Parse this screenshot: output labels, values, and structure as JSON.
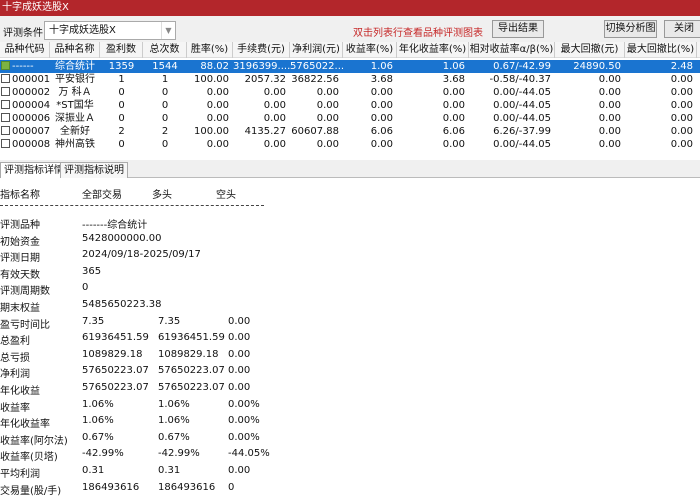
{
  "window": {
    "title": "十字成妖选股X"
  },
  "toolbar": {
    "condition_label": "评测条件:",
    "condition_value": "十字成妖选股X",
    "hint": "双击列表行查看品种评测图表",
    "export": "导出结果",
    "switch_chart": "切换分析图",
    "close": "关闭"
  },
  "table": {
    "headers": [
      "品种代码",
      "品种名称",
      "盈利数",
      "总次数",
      "胜率(%)",
      "手续费(元)",
      "净利润(元)",
      "收益率(%)",
      "年化收益率(%)",
      "相对收益率α/β(%)",
      "最大回撤(元)",
      "最大回撤比(%)"
    ],
    "rows": [
      [
        "------",
        "综合统计",
        "1359",
        "1544",
        "88.02",
        "3196399....",
        "5765022...",
        "1.06",
        "1.06",
        "0.67/-42.99",
        "24890.50",
        "2.48"
      ],
      [
        "000001",
        "平安银行",
        "1",
        "1",
        "100.00",
        "2057.32",
        "36822.56",
        "3.68",
        "3.68",
        "-0.58/-40.37",
        "0.00",
        "0.00"
      ],
      [
        "000002",
        "万 科Ａ",
        "0",
        "0",
        "0.00",
        "0.00",
        "0.00",
        "0.00",
        "0.00",
        "0.00/-44.05",
        "0.00",
        "0.00"
      ],
      [
        "000004",
        "*ST国华",
        "0",
        "0",
        "0.00",
        "0.00",
        "0.00",
        "0.00",
        "0.00",
        "0.00/-44.05",
        "0.00",
        "0.00"
      ],
      [
        "000006",
        "深振业Ａ",
        "0",
        "0",
        "0.00",
        "0.00",
        "0.00",
        "0.00",
        "0.00",
        "0.00/-44.05",
        "0.00",
        "0.00"
      ],
      [
        "000007",
        "全新好",
        "2",
        "2",
        "100.00",
        "4135.27",
        "60607.88",
        "6.06",
        "6.06",
        "6.26/-37.99",
        "0.00",
        "0.00"
      ],
      [
        "000008",
        "神州高铁",
        "0",
        "0",
        "0.00",
        "0.00",
        "0.00",
        "0.00",
        "0.00",
        "0.00/-44.05",
        "0.00",
        "0.00"
      ]
    ]
  },
  "tabs": [
    "评测指标详情",
    "评测指标说明"
  ],
  "detail": {
    "headers": [
      "指标名称",
      "全部交易",
      "多头",
      "空头"
    ],
    "rows": [
      [
        "评测品种",
        "-------综合统计",
        "",
        ""
      ],
      [
        "初始资金",
        "5428000000.00",
        "",
        ""
      ],
      [
        "评测日期",
        "2024/09/18-2025/09/17",
        "",
        ""
      ],
      [
        "有效天数",
        "365",
        "",
        ""
      ],
      [
        "评测周期数",
        " 0",
        "",
        ""
      ],
      [
        "期末权益",
        "5485650223.38",
        "",
        ""
      ],
      [
        "盈亏时间比",
        "7.35",
        "7.35",
        "0.00"
      ],
      [
        "总盈利",
        "61936451.59",
        "61936451.59",
        "0.00"
      ],
      [
        "总亏损",
        "1089829.18",
        "1089829.18",
        "0.00"
      ],
      [
        "净利润",
        "57650223.07",
        "57650223.07",
        "0.00"
      ],
      [
        "年化收益",
        "57650223.07",
        "57650223.07",
        "0.00"
      ],
      [
        "收益率",
        "1.06%",
        "1.06%",
        "0.00%"
      ],
      [
        "年化收益率",
        "1.06%",
        "1.06%",
        "0.00%"
      ],
      [
        "收益率(阿尔法)",
        "0.67%",
        "0.67%",
        "0.00%"
      ],
      [
        "收益率(贝塔)",
        "-42.99%",
        "-42.99%",
        "-44.05%"
      ],
      [
        "平均利润",
        "0.31",
        "0.31",
        "0.00"
      ],
      [
        "交易量(股/手)",
        "186493616",
        "186493616",
        "0"
      ]
    ]
  }
}
